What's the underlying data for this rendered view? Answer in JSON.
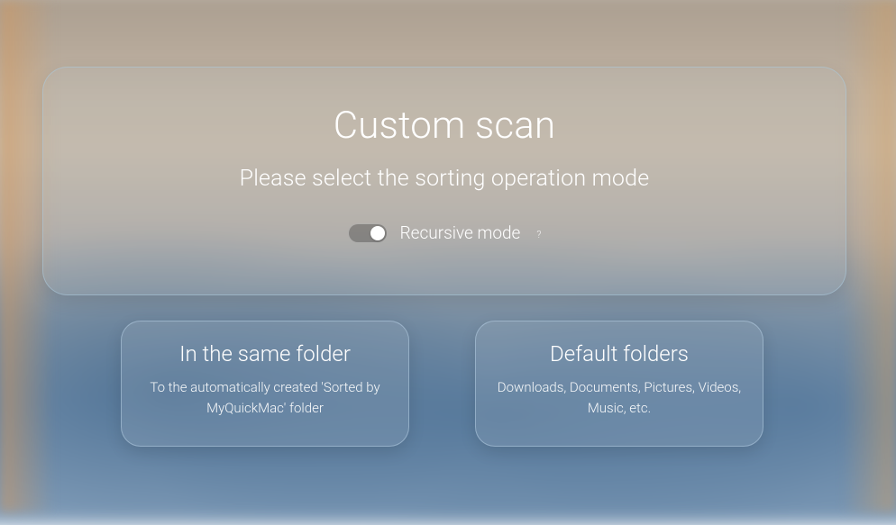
{
  "main": {
    "title": "Custom scan",
    "subtitle": "Please select the sorting operation mode",
    "toggle": {
      "label": "Recursive mode",
      "on": true,
      "help": "?"
    }
  },
  "options": {
    "same_folder": {
      "title": "In the same folder",
      "desc": "To the automatically created 'Sorted by MyQuickMac' folder"
    },
    "default_folders": {
      "title": "Default folders",
      "desc": "Downloads, Documents, Pictures, Videos, Music, etc."
    }
  }
}
